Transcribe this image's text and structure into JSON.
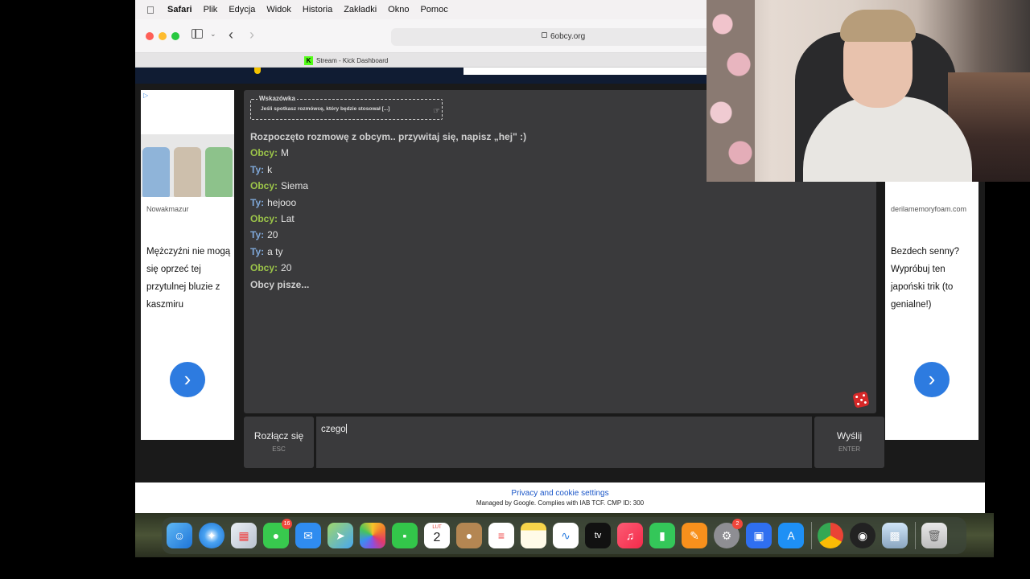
{
  "menubar": {
    "items": [
      "Safari",
      "Plik",
      "Edycja",
      "Widok",
      "Historia",
      "Zakładki",
      "Okno",
      "Pomoc"
    ]
  },
  "browser": {
    "url": "6obcy.org",
    "tab_title": "Stream - Kick Dashboard",
    "tab_icon_letter": "K"
  },
  "ads": {
    "left": {
      "source": "Nowakmazur",
      "headline": "Mężczyźni nie mogą się oprzeć tej przytulnej bluzie z kaszmiru",
      "arrow": "›"
    },
    "right": {
      "source": "derilamemoryfoam.com",
      "headline": "Bezdech senny? Wypróbuj ten japoński trik (to genialne!)",
      "arrow": "›"
    }
  },
  "tip": {
    "title": "Wskazówka",
    "text": "Jeśli spotkasz rozmówcę, który będzie stosował [...]"
  },
  "chat": {
    "start": "Rozpoczęto rozmowę z obcym.. przywitaj się, napisz „hej\" :)",
    "messages": [
      {
        "who": "Obcy:",
        "text": "M"
      },
      {
        "who": "Ty:",
        "text": "k"
      },
      {
        "who": "Obcy:",
        "text": "Siema"
      },
      {
        "who": "Ty:",
        "text": "hejooo"
      },
      {
        "who": "Obcy:",
        "text": "Lat"
      },
      {
        "who": "Ty:",
        "text": "20"
      },
      {
        "who": "Ty:",
        "text": "a ty"
      },
      {
        "who": "Obcy:",
        "text": "20"
      }
    ],
    "typing": "Obcy pisze..."
  },
  "controls": {
    "disconnect_label": "Rozłącz się",
    "disconnect_key": "ESC",
    "input_value": "czego",
    "send_label": "Wyślij",
    "send_key": "ENTER"
  },
  "footer": {
    "privacy": "Privacy and cookie settings",
    "managed": "Managed by Google. Complies with IAB TCF. CMP ID: 300"
  },
  "dock": {
    "messages_badge": "16",
    "calendar_month": "LUT",
    "calendar_day": "2",
    "settings_badge": "2",
    "tv_label": "tv"
  },
  "colors": {
    "obcy": "#9cc549",
    "ty": "#7fa8d9",
    "chat_bg": "#3a3a3c",
    "accent_blue": "#2d7be0"
  }
}
